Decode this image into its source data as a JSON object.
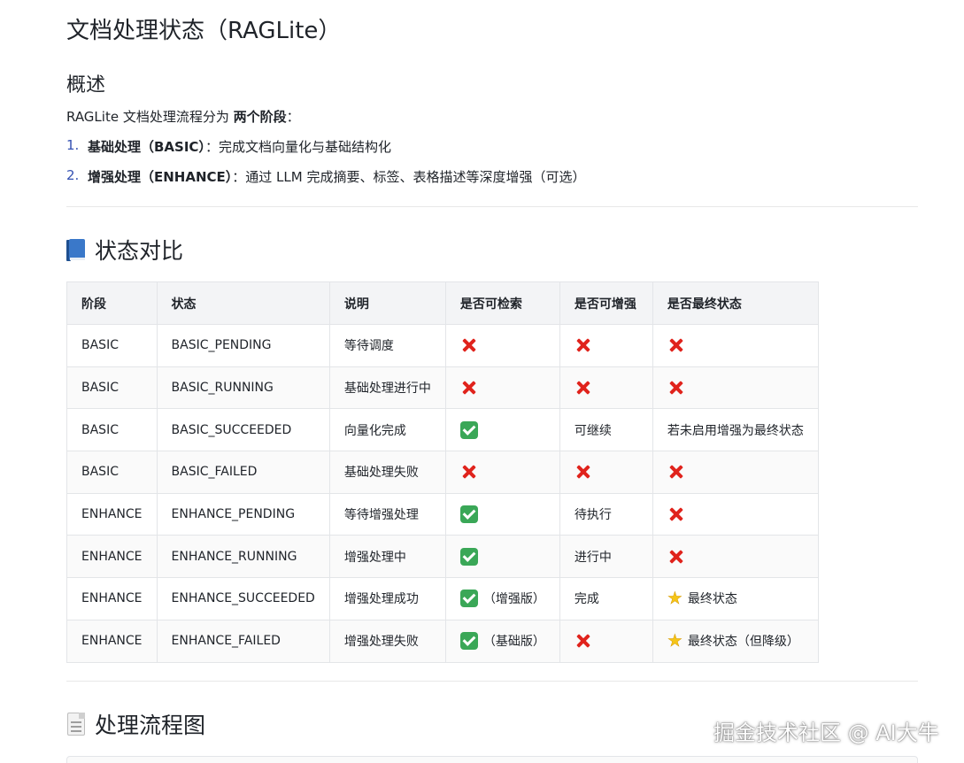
{
  "title": "文档处理状态（RAGLite）",
  "overview": {
    "heading": "概述",
    "intro_prefix": "RAGLite 文档处理流程分为 ",
    "intro_bold": "两个阶段",
    "intro_suffix": "：",
    "items": [
      {
        "num": "1.",
        "bold": "基础处理（BASIC）",
        "text": "：完成文档向量化与基础结构化"
      },
      {
        "num": "2.",
        "bold": "增强处理（ENHANCE）",
        "text": "：通过 LLM 完成摘要、标签、表格描述等深度增强（可选）"
      }
    ]
  },
  "compare_section": {
    "heading": "状态对比",
    "icon": "blue-book-icon"
  },
  "table": {
    "headers": [
      "阶段",
      "状态",
      "说明",
      "是否可检索",
      "是否可增强",
      "是否最终状态"
    ],
    "rows": [
      {
        "stage": "BASIC",
        "state": "BASIC_PENDING",
        "desc": "等待调度",
        "searchable": {
          "icon": "cross-mark-icon",
          "text": ""
        },
        "enhanceable": {
          "icon": "cross-mark-icon",
          "text": ""
        },
        "final": {
          "icon": "cross-mark-icon",
          "text": ""
        }
      },
      {
        "stage": "BASIC",
        "state": "BASIC_RUNNING",
        "desc": "基础处理进行中",
        "searchable": {
          "icon": "cross-mark-icon",
          "text": ""
        },
        "enhanceable": {
          "icon": "cross-mark-icon",
          "text": ""
        },
        "final": {
          "icon": "cross-mark-icon",
          "text": ""
        }
      },
      {
        "stage": "BASIC",
        "state": "BASIC_SUCCEEDED",
        "desc": "向量化完成",
        "searchable": {
          "icon": "check-mark-icon",
          "text": ""
        },
        "enhanceable": {
          "icon": "",
          "text": "可继续"
        },
        "final": {
          "icon": "",
          "text": "若未启用增强为最终状态"
        }
      },
      {
        "stage": "BASIC",
        "state": "BASIC_FAILED",
        "desc": "基础处理失败",
        "searchable": {
          "icon": "cross-mark-icon",
          "text": ""
        },
        "enhanceable": {
          "icon": "cross-mark-icon",
          "text": ""
        },
        "final": {
          "icon": "cross-mark-icon",
          "text": ""
        }
      },
      {
        "stage": "ENHANCE",
        "state": "ENHANCE_PENDING",
        "desc": "等待增强处理",
        "searchable": {
          "icon": "check-mark-icon",
          "text": ""
        },
        "enhanceable": {
          "icon": "",
          "text": "待执行"
        },
        "final": {
          "icon": "cross-mark-icon",
          "text": ""
        }
      },
      {
        "stage": "ENHANCE",
        "state": "ENHANCE_RUNNING",
        "desc": "增强处理中",
        "searchable": {
          "icon": "check-mark-icon",
          "text": ""
        },
        "enhanceable": {
          "icon": "",
          "text": "进行中"
        },
        "final": {
          "icon": "cross-mark-icon",
          "text": ""
        }
      },
      {
        "stage": "ENHANCE",
        "state": "ENHANCE_SUCCEEDED",
        "desc": "增强处理成功",
        "searchable": {
          "icon": "check-mark-icon",
          "text": "（增强版）"
        },
        "enhanceable": {
          "icon": "",
          "text": "完成"
        },
        "final": {
          "icon": "star-icon",
          "text": "最终状态"
        }
      },
      {
        "stage": "ENHANCE",
        "state": "ENHANCE_FAILED",
        "desc": "增强处理失败",
        "searchable": {
          "icon": "check-mark-icon",
          "text": "（基础版）"
        },
        "enhanceable": {
          "icon": "cross-mark-icon",
          "text": ""
        },
        "final": {
          "icon": "star-icon",
          "text": "最终状态（但降级）"
        }
      }
    ]
  },
  "flow_section": {
    "heading": "处理流程图",
    "icon": "document-icon"
  },
  "watermark": "掘金技术社区 @ AI大牛",
  "colors": {
    "list_number": "#3451b2",
    "cross": "#e0231c",
    "check": "#3aa757",
    "star": "#f5c518",
    "table_header_bg": "#f3f4f6"
  }
}
